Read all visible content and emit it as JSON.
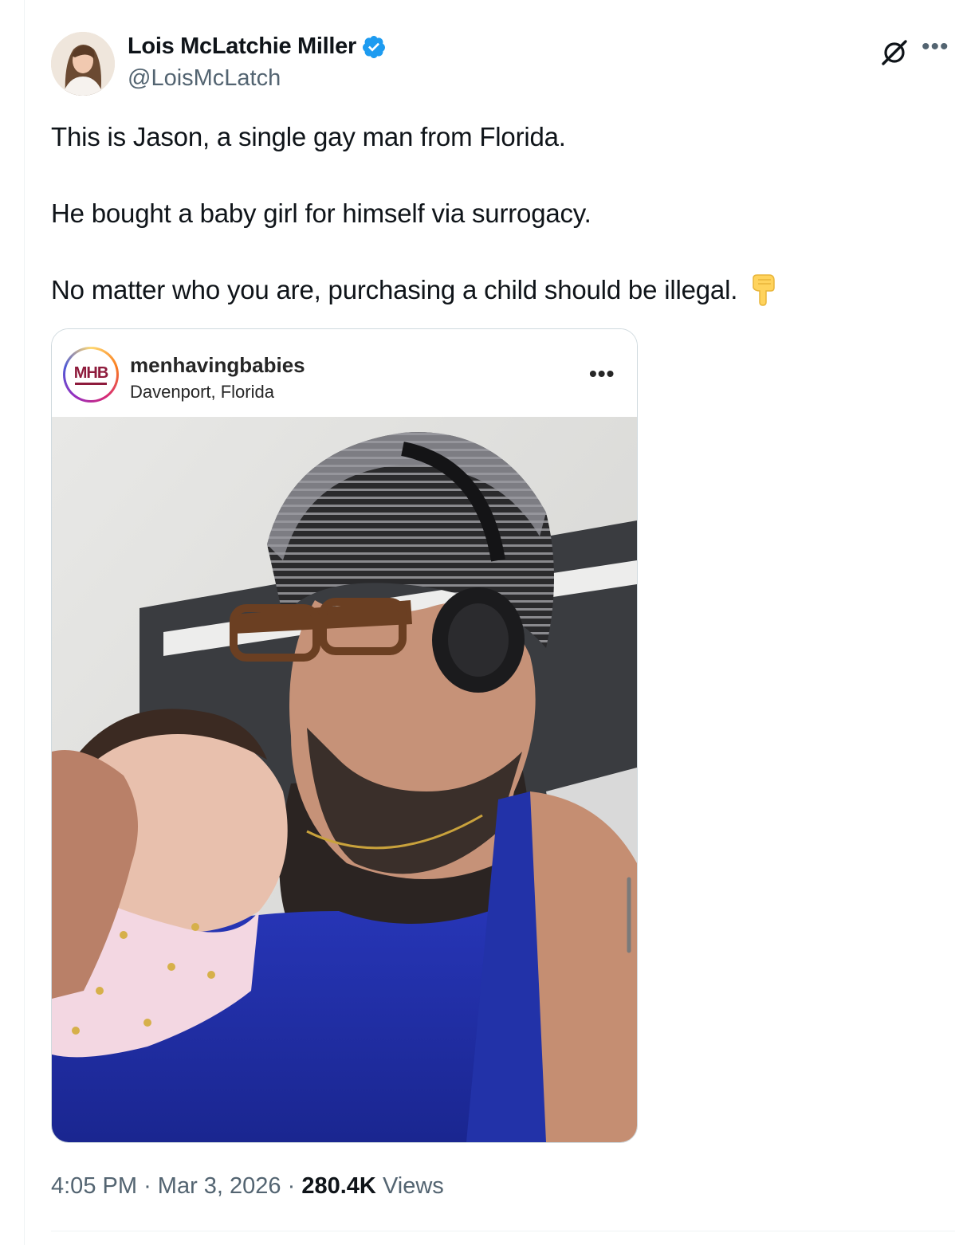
{
  "author": {
    "name": "Lois McLatchie Miller",
    "handle": "@LoisMcLatch",
    "verified": true
  },
  "tweet": {
    "line1": "This is Jason, a single gay man from Florida.",
    "line2": "He bought a baby girl for himself via surrogacy.",
    "line3": "No matter who you are, purchasing a child should be illegal."
  },
  "embed": {
    "account": "menhavingbabies",
    "location": "Davenport, Florida",
    "logo_text": "MHB"
  },
  "meta": {
    "time": "4:05 PM",
    "date": "Mar 3, 2026",
    "views_count": "280.4K",
    "views_label": "Views",
    "separator": "·"
  },
  "icons": {
    "grok": "grok-icon",
    "more": "more-options-icon",
    "verified": "verified-badge-icon",
    "hand": "backhand-index-pointing-down-icon"
  },
  "colors": {
    "text": "#0f1419",
    "muted": "#536471",
    "verified": "#1d9bf0",
    "border": "#cfd9de"
  }
}
